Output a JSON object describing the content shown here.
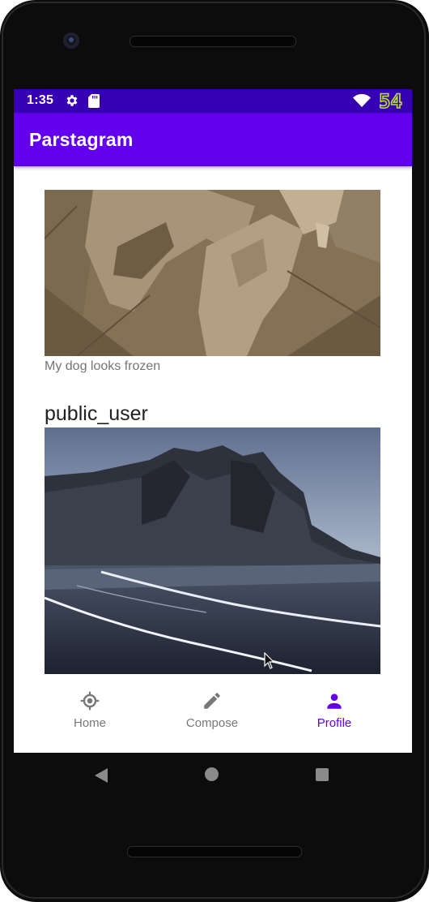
{
  "status_bar": {
    "time": "1:35",
    "icons": [
      "gear-icon",
      "sd-card-icon",
      "wifi-icon"
    ],
    "overlay_text": "54"
  },
  "app_bar": {
    "title": "Parstagram"
  },
  "feed": {
    "posts": [
      {
        "username": "",
        "image_description_icon": "dog-photo",
        "caption": "My dog looks frozen"
      },
      {
        "username": "public_user",
        "image_description_icon": "mountain-beach-photo",
        "caption": ""
      }
    ]
  },
  "bottom_nav": {
    "items": [
      {
        "label": "Home",
        "icon": "target-icon",
        "active": false
      },
      {
        "label": "Compose",
        "icon": "pencil-icon",
        "active": false
      },
      {
        "label": "Profile",
        "icon": "person-icon",
        "active": true
      }
    ]
  },
  "colors": {
    "status_bar": "#3700b3",
    "app_bar": "#6200ee",
    "active_nav": "#6200ee",
    "inactive_nav": "#777777"
  }
}
